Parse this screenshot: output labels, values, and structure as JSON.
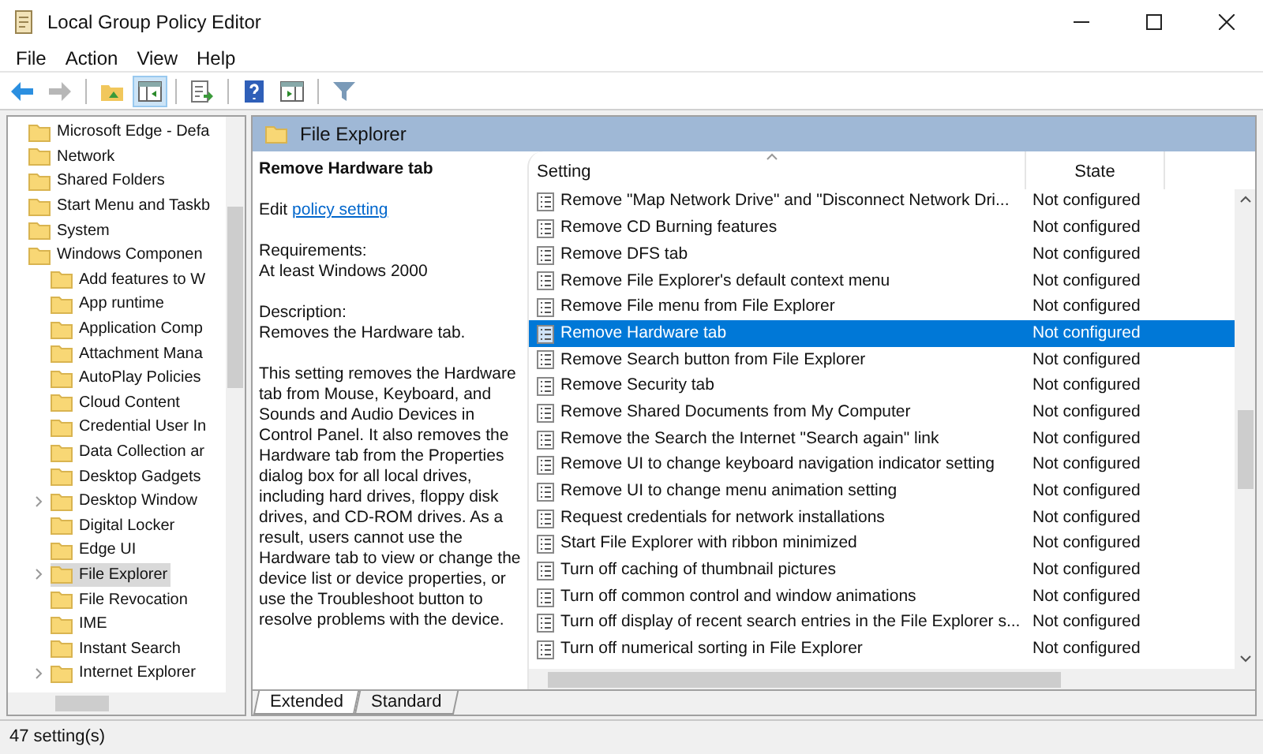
{
  "window": {
    "title": "Local Group Policy Editor"
  },
  "menu": [
    "File",
    "Action",
    "View",
    "Help"
  ],
  "toolbar": [
    {
      "kind": "back",
      "disabled": false,
      "pressed": false
    },
    {
      "kind": "forward",
      "disabled": true,
      "pressed": false
    },
    {
      "kind": "sep"
    },
    {
      "kind": "up",
      "disabled": false,
      "pressed": false
    },
    {
      "kind": "tree",
      "disabled": false,
      "pressed": true
    },
    {
      "kind": "sep"
    },
    {
      "kind": "export",
      "disabled": false,
      "pressed": false
    },
    {
      "kind": "sep"
    },
    {
      "kind": "help",
      "disabled": false,
      "pressed": false
    },
    {
      "kind": "console",
      "disabled": false,
      "pressed": false
    },
    {
      "kind": "sep"
    },
    {
      "kind": "filter",
      "disabled": false,
      "pressed": false
    }
  ],
  "tree": [
    {
      "label": "Microsoft Edge - Defa",
      "expandable": false,
      "selected": false
    },
    {
      "label": "Network",
      "expandable": false,
      "selected": false
    },
    {
      "label": "Shared Folders",
      "expandable": false,
      "selected": false
    },
    {
      "label": "Start Menu and Taskb",
      "expandable": false,
      "selected": false
    },
    {
      "label": "System",
      "expandable": false,
      "selected": false
    },
    {
      "label": "Windows Componen",
      "expandable": false,
      "selected": false,
      "children": [
        {
          "label": "Add features to W",
          "expandable": false,
          "selected": false
        },
        {
          "label": "App runtime",
          "expandable": false,
          "selected": false
        },
        {
          "label": "Application Comp",
          "expandable": false,
          "selected": false
        },
        {
          "label": "Attachment Mana",
          "expandable": false,
          "selected": false
        },
        {
          "label": "AutoPlay Policies",
          "expandable": false,
          "selected": false
        },
        {
          "label": "Cloud Content",
          "expandable": false,
          "selected": false
        },
        {
          "label": "Credential User In",
          "expandable": false,
          "selected": false
        },
        {
          "label": "Data Collection ar",
          "expandable": false,
          "selected": false
        },
        {
          "label": "Desktop Gadgets",
          "expandable": false,
          "selected": false
        },
        {
          "label": "Desktop Window",
          "expandable": true,
          "selected": false
        },
        {
          "label": "Digital Locker",
          "expandable": false,
          "selected": false
        },
        {
          "label": "Edge UI",
          "expandable": false,
          "selected": false
        },
        {
          "label": "File Explorer",
          "expandable": true,
          "selected": true
        },
        {
          "label": "File Revocation",
          "expandable": false,
          "selected": false
        },
        {
          "label": "IME",
          "expandable": false,
          "selected": false
        },
        {
          "label": "Instant Search",
          "expandable": false,
          "selected": false
        },
        {
          "label": "Internet Explorer",
          "expandable": true,
          "selected": false
        }
      ]
    }
  ],
  "details": {
    "header": "File Explorer",
    "title": "Remove Hardware tab",
    "edit_prefix": "Edit",
    "edit_link": "policy setting",
    "requirements_label": "Requirements:",
    "requirements": "At least Windows 2000",
    "description_label": "Description:",
    "description_summary": "Removes the Hardware tab.",
    "description_body": "This setting removes the Hardware tab from Mouse, Keyboard, and Sounds and Audio Devices in Control Panel. It also removes the Hardware tab from the Properties dialog box for all local drives, including hard drives, floppy disk drives, and CD-ROM drives. As a result, users cannot use the Hardware tab to view or change the device list or device properties, or use the Troubleshoot button to resolve problems with the device."
  },
  "tabs": [
    {
      "label": "Extended",
      "selected": true
    },
    {
      "label": "Standard",
      "selected": false
    }
  ],
  "table": {
    "columns": [
      "Setting",
      "State"
    ],
    "rows": [
      {
        "setting": "Remove \"Map Network Drive\" and \"Disconnect Network Dri...",
        "state": "Not configured",
        "selected": false
      },
      {
        "setting": "Remove CD Burning features",
        "state": "Not configured",
        "selected": false
      },
      {
        "setting": "Remove DFS tab",
        "state": "Not configured",
        "selected": false
      },
      {
        "setting": "Remove File Explorer's default context menu",
        "state": "Not configured",
        "selected": false
      },
      {
        "setting": "Remove File menu from File Explorer",
        "state": "Not configured",
        "selected": false
      },
      {
        "setting": "Remove Hardware tab",
        "state": "Not configured",
        "selected": true
      },
      {
        "setting": "Remove Search button from File Explorer",
        "state": "Not configured",
        "selected": false
      },
      {
        "setting": "Remove Security tab",
        "state": "Not configured",
        "selected": false
      },
      {
        "setting": "Remove Shared Documents from My Computer",
        "state": "Not configured",
        "selected": false
      },
      {
        "setting": "Remove the Search the Internet \"Search again\" link",
        "state": "Not configured",
        "selected": false
      },
      {
        "setting": "Remove UI to change keyboard navigation indicator setting",
        "state": "Not configured",
        "selected": false
      },
      {
        "setting": "Remove UI to change menu animation setting",
        "state": "Not configured",
        "selected": false
      },
      {
        "setting": "Request credentials for network installations",
        "state": "Not configured",
        "selected": false
      },
      {
        "setting": "Start File Explorer with ribbon minimized",
        "state": "Not configured",
        "selected": false
      },
      {
        "setting": "Turn off caching of thumbnail pictures",
        "state": "Not configured",
        "selected": false
      },
      {
        "setting": "Turn off common control and window animations",
        "state": "Not configured",
        "selected": false
      },
      {
        "setting": "Turn off display of recent search entries in the File Explorer s...",
        "state": "Not configured",
        "selected": false
      },
      {
        "setting": "Turn off numerical sorting in File Explorer",
        "state": "Not configured",
        "selected": false
      }
    ]
  },
  "status_bar": "47 setting(s)"
}
